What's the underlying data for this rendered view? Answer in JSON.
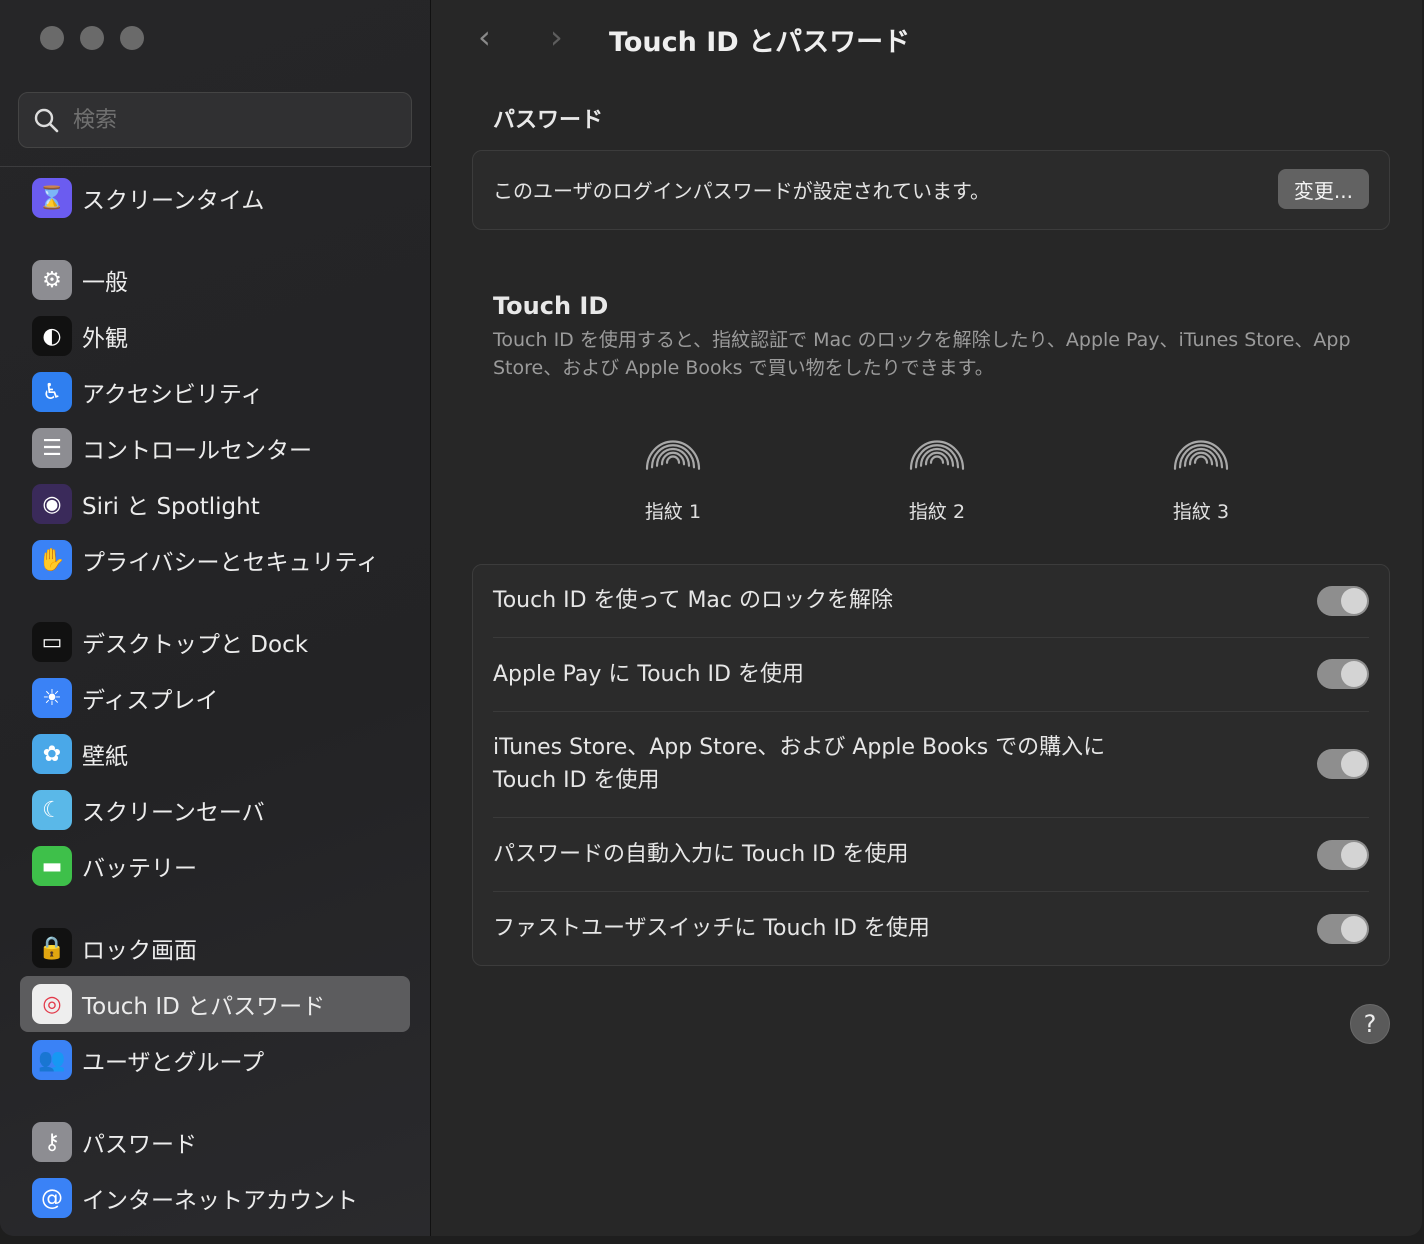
{
  "search": {
    "placeholder": "検索"
  },
  "sidebar": {
    "items": [
      {
        "label": "スクリーンタイム",
        "icon": "hourglass-icon"
      },
      {
        "label": "一般",
        "icon": "gear-icon"
      },
      {
        "label": "外観",
        "icon": "appearance-icon"
      },
      {
        "label": "アクセシビリティ",
        "icon": "accessibility-icon"
      },
      {
        "label": "コントロールセンター",
        "icon": "control-center-icon"
      },
      {
        "label": "Siri と Spotlight",
        "icon": "siri-icon"
      },
      {
        "label": "プライバシーとセキュリティ",
        "icon": "hand-icon"
      },
      {
        "label": "デスクトップと Dock",
        "icon": "dock-icon"
      },
      {
        "label": "ディスプレイ",
        "icon": "sun-icon"
      },
      {
        "label": "壁紙",
        "icon": "flower-icon"
      },
      {
        "label": "スクリーンセーバ",
        "icon": "screensaver-icon"
      },
      {
        "label": "バッテリー",
        "icon": "battery-icon"
      },
      {
        "label": "ロック画面",
        "icon": "lock-icon"
      },
      {
        "label": "Touch ID とパスワード",
        "icon": "fingerprint-icon"
      },
      {
        "label": "ユーザとグループ",
        "icon": "users-icon"
      },
      {
        "label": "パスワード",
        "icon": "key-icon"
      },
      {
        "label": "インターネットアカウント",
        "icon": "at-icon"
      }
    ]
  },
  "header": {
    "title": "Touch ID とパスワード",
    "back": "‹",
    "forward": "›"
  },
  "password": {
    "heading": "パスワード",
    "status": "このユーザのログインパスワードが設定されています。",
    "change_label": "変更..."
  },
  "touchid": {
    "heading": "Touch ID",
    "description": "Touch ID を使用すると、指紋認証で Mac のロックを解除したり、Apple Pay、iTunes Store、App Store、および Apple Books で買い物をしたりできます。",
    "fingers": [
      "指紋 1",
      "指紋 2",
      "指紋 3"
    ]
  },
  "options": [
    {
      "label": "Touch ID を使って Mac のロックを解除",
      "on": true
    },
    {
      "label": "Apple Pay に Touch ID を使用",
      "on": true
    },
    {
      "label": "iTunes Store、App Store、および Apple Books での購入に Touch ID を使用",
      "on": true
    },
    {
      "label": "パスワードの自動入力に Touch ID を使用",
      "on": true
    },
    {
      "label": "ファストユーザスイッチに Touch ID を使用",
      "on": true
    }
  ],
  "help": "?"
}
